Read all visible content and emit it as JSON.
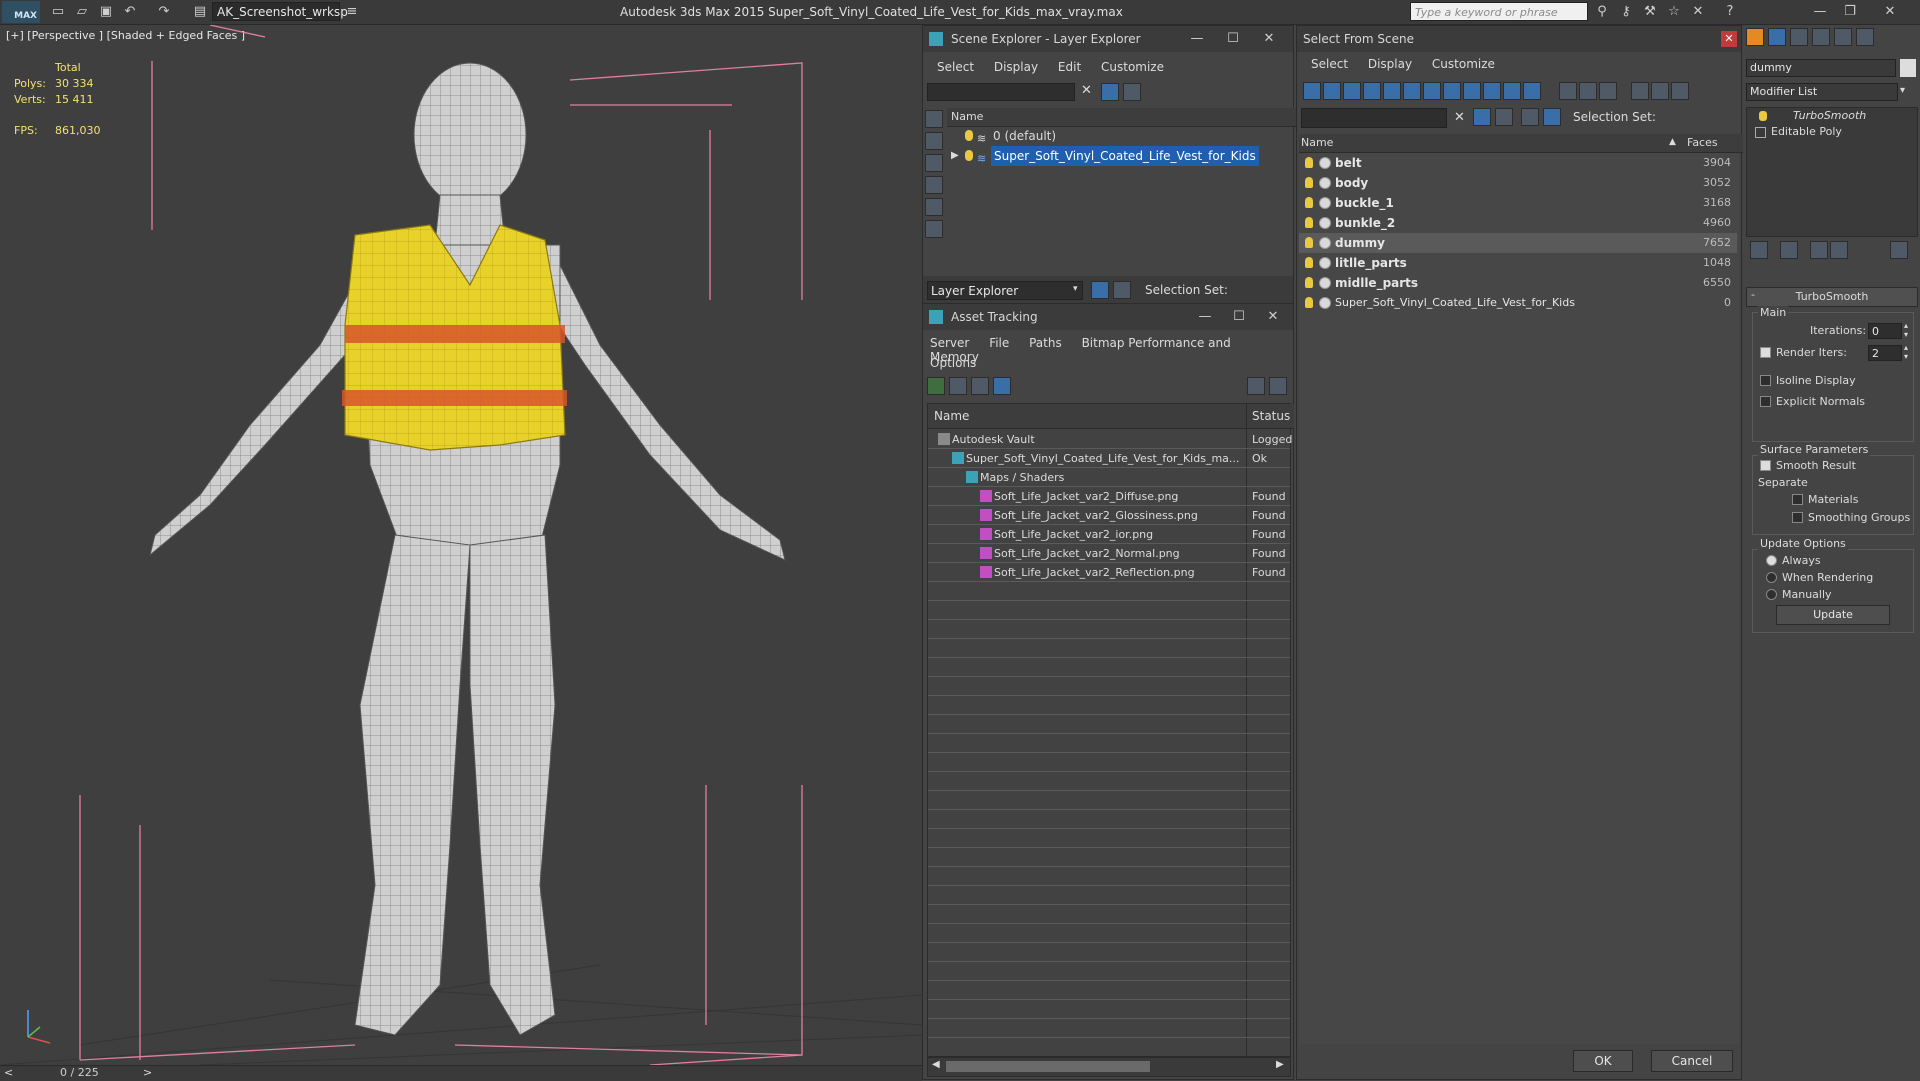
{
  "app": {
    "logo": "MAX",
    "workspace": "AK_Screenshot_wrksp",
    "title": "Autodesk 3ds Max  2015    Super_Soft_Vinyl_Coated_Life_Vest_for_Kids_max_vray.max",
    "search_placeholder": "Type a keyword or phrase"
  },
  "viewport": {
    "label": "[+] [Perspective ] [Shaded + Edged Faces ]",
    "stats": {
      "total_label": "Total",
      "polys_label": "Polys:",
      "polys_value": "30 334",
      "verts_label": "Verts:",
      "verts_value": "15 411",
      "fps_label": "FPS:",
      "fps_value": "861,030"
    },
    "timeline": "0 / 225",
    "nav_prev": "<",
    "nav_next": ">"
  },
  "scene_explorer": {
    "title": "Scene Explorer - Layer Explorer",
    "menu": [
      "Select",
      "Display",
      "Edit",
      "Customize"
    ],
    "col_name": "Name",
    "rows": [
      {
        "label": "0 (default)"
      },
      {
        "label": "Super_Soft_Vinyl_Coated_Life_Vest_for_Kids"
      }
    ],
    "footer_combo": "Layer Explorer",
    "selection_set": "Selection Set:"
  },
  "asset_tracking": {
    "title": "Asset Tracking",
    "menu": [
      "Server",
      "File",
      "Paths",
      "Bitmap Performance and Memory"
    ],
    "menu2": "Options",
    "col_name": "Name",
    "col_status": "Status",
    "rows": [
      {
        "name": "Autodesk Vault",
        "status": "Logged",
        "indent": 0
      },
      {
        "name": "Super_Soft_Vinyl_Coated_Life_Vest_for_Kids_ma...",
        "status": "Ok",
        "indent": 1
      },
      {
        "name": "Maps / Shaders",
        "status": "",
        "indent": 2
      },
      {
        "name": "Soft_Life_Jacket_var2_Diffuse.png",
        "status": "Found",
        "indent": 3
      },
      {
        "name": "Soft_Life_Jacket_var2_Glossiness.png",
        "status": "Found",
        "indent": 3
      },
      {
        "name": "Soft_Life_Jacket_var2_ior.png",
        "status": "Found",
        "indent": 3
      },
      {
        "name": "Soft_Life_Jacket_var2_Normal.png",
        "status": "Found",
        "indent": 3
      },
      {
        "name": "Soft_Life_Jacket_var2_Reflection.png",
        "status": "Found",
        "indent": 3
      }
    ]
  },
  "select_from_scene": {
    "title": "Select From Scene",
    "menu": [
      "Select",
      "Display",
      "Customize"
    ],
    "selection_set": "Selection Set:",
    "col_name": "Name",
    "col_faces": "Faces",
    "objects": [
      {
        "name": "belt",
        "faces": "3904"
      },
      {
        "name": "body",
        "faces": "3052"
      },
      {
        "name": "buckle_1",
        "faces": "3168"
      },
      {
        "name": "bunkle_2",
        "faces": "4960"
      },
      {
        "name": "dummy",
        "faces": "7652"
      },
      {
        "name": "litlle_parts",
        "faces": "1048"
      },
      {
        "name": "midlle_parts",
        "faces": "6550"
      },
      {
        "name": "Super_Soft_Vinyl_Coated_Life_Vest_for_Kids",
        "faces": "0"
      }
    ],
    "ok": "OK",
    "cancel": "Cancel"
  },
  "modifier_panel": {
    "object_name": "dummy",
    "modifier_list": "Modifier List",
    "stack": [
      "TurboSmooth",
      "Editable Poly"
    ],
    "rollout_title": "TurboSmooth",
    "main_label": "Main",
    "iterations_label": "Iterations:",
    "iterations_value": "0",
    "render_iters_label": "Render Iters:",
    "render_iters_value": "2",
    "isoline": "Isoline Display",
    "explicit_normals": "Explicit Normals",
    "surface_params": "Surface Parameters",
    "smooth_result": "Smooth Result",
    "separate": "Separate",
    "materials": "Materials",
    "smoothing_groups": "Smoothing Groups",
    "update_options": "Update Options",
    "always": "Always",
    "when_rendering": "When Rendering",
    "manually": "Manually",
    "update_btn": "Update"
  }
}
